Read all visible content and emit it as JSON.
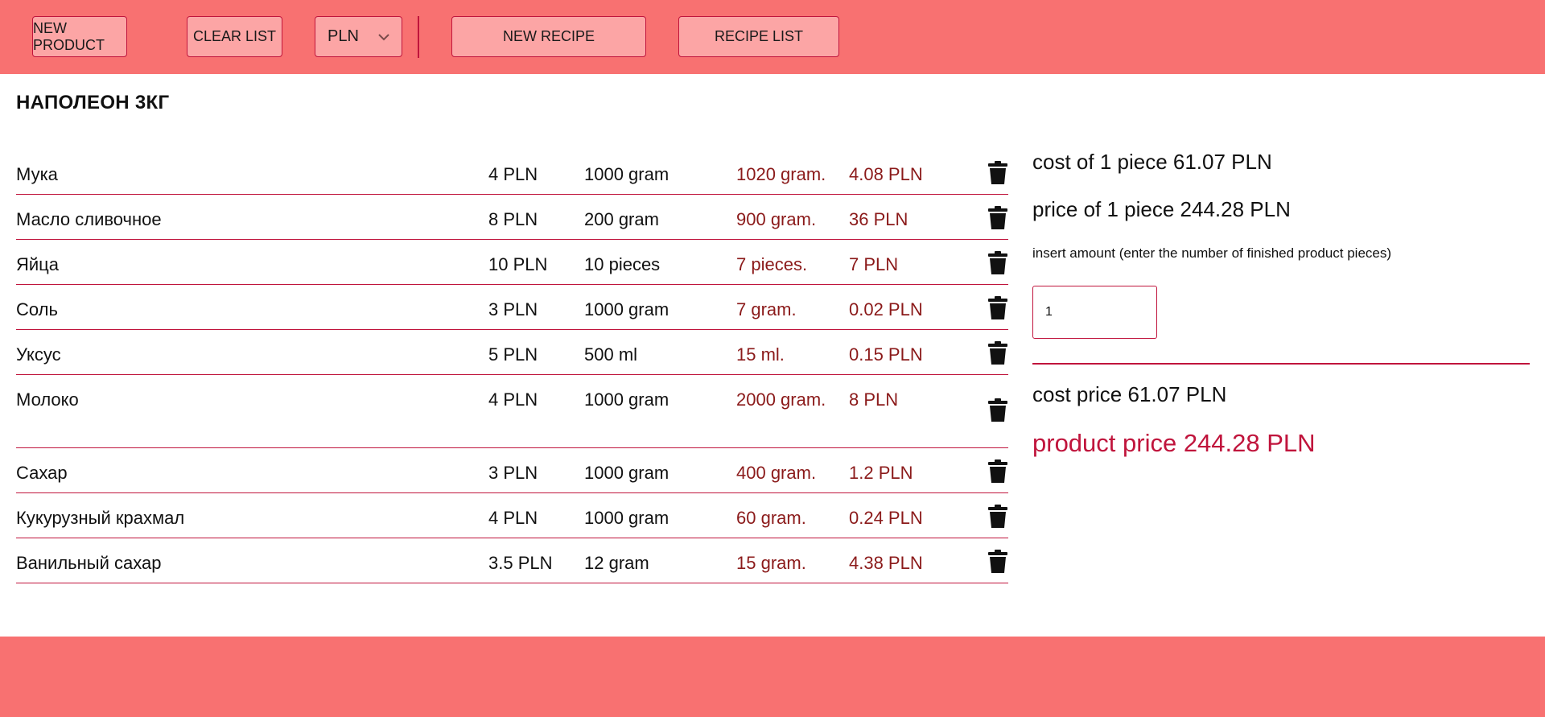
{
  "toolbar": {
    "new_product": "NEW PRODUCT",
    "clear_list": "CLEAR LIST",
    "currency_selected": "PLN",
    "new_recipe": "NEW RECIPE",
    "recipe_list": "RECIPE LIST"
  },
  "recipe": {
    "title": "НАПОЛЕОН 3КГ"
  },
  "ingredients": [
    {
      "name": "Мука",
      "price": "4 PLN",
      "unit": "1000 gram",
      "amount": "1020 gram.",
      "cost": "4.08 PLN"
    },
    {
      "name": "Масло сливочное",
      "price": "8 PLN",
      "unit": "200 gram",
      "amount": "900 gram.",
      "cost": "36 PLN"
    },
    {
      "name": "Яйца",
      "price": "10 PLN",
      "unit": "10 pieces",
      "amount": "7 pieces.",
      "cost": "7 PLN"
    },
    {
      "name": "Соль",
      "price": "3 PLN",
      "unit": "1000 gram",
      "amount": "7 gram.",
      "cost": "0.02 PLN"
    },
    {
      "name": "Уксус",
      "price": "5 PLN",
      "unit": "500 ml",
      "amount": "15 ml.",
      "cost": "0.15 PLN"
    },
    {
      "name": "Молоко",
      "price": "4 PLN",
      "unit": "1000 gram",
      "amount": "2000 gram.",
      "cost": "8 PLN"
    },
    {
      "name": "Сахар",
      "price": "3 PLN",
      "unit": "1000 gram",
      "amount": "400 gram.",
      "cost": "1.2 PLN"
    },
    {
      "name": "Кукурузный крахмал",
      "price": "4 PLN",
      "unit": "1000 gram",
      "amount": "60 gram.",
      "cost": "0.24 PLN"
    },
    {
      "name": "Ванильный сахар",
      "price": "3.5 PLN",
      "unit": "12 gram",
      "amount": "15 gram.",
      "cost": "4.38 PLN"
    }
  ],
  "summary": {
    "cost_of_piece": "cost of 1 piece 61.07 PLN",
    "price_of_piece": "price of 1 piece 244.28 PLN",
    "hint": "insert amount (enter the number of finished product pieces)",
    "amount_value": "1",
    "cost_price": "cost price 61.07 PLN",
    "product_price": "product price 244.28 PLN"
  },
  "colors": {
    "header_bg": "#f87171",
    "button_bg": "#fca5a5",
    "accent": "#c0143c",
    "amount_text": "#8b1a1a"
  },
  "icons": {
    "delete": "trash-icon",
    "dropdown": "chevron-down-icon"
  }
}
